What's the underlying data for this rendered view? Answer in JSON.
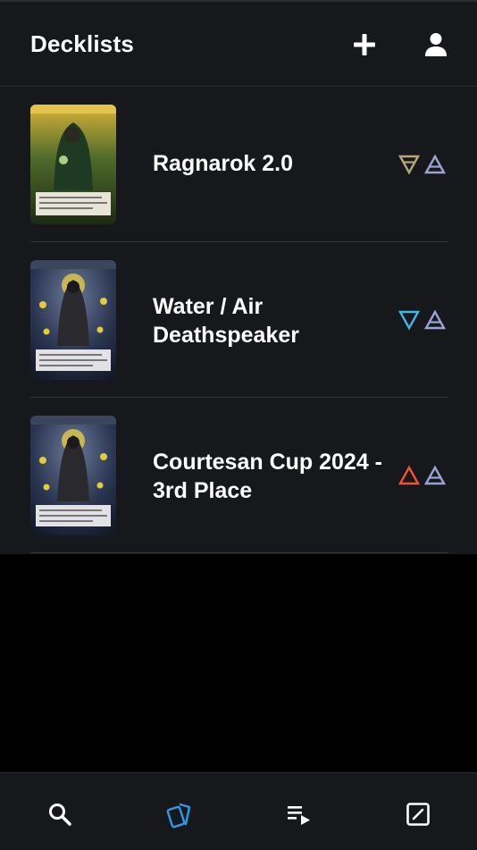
{
  "header": {
    "title": "Decklists",
    "add_icon": "plus-icon",
    "profile_icon": "user-icon"
  },
  "decks": [
    {
      "name": "Ragnarok 2.0",
      "card_image": "card-art-druid",
      "elements": [
        "earth",
        "air"
      ]
    },
    {
      "name": "Water / Air Deathspeaker",
      "card_image": "card-art-deathspeaker",
      "elements": [
        "water",
        "air"
      ]
    },
    {
      "name": "Courtesan Cup 2024 - 3rd Place",
      "card_image": "card-art-deathspeaker",
      "elements": [
        "fire",
        "air"
      ]
    }
  ],
  "element_colors": {
    "earth": "#b7a57a",
    "air": "#9aa3d6",
    "water": "#3fb6e8",
    "fire": "#f4512c"
  },
  "nav": [
    {
      "icon": "search-icon",
      "active": false
    },
    {
      "icon": "cards-icon",
      "active": true
    },
    {
      "icon": "playlist-icon",
      "active": false
    },
    {
      "icon": "edit-icon",
      "active": false
    }
  ],
  "colors": {
    "accent": "#2b9be8",
    "background": "#16181c"
  }
}
